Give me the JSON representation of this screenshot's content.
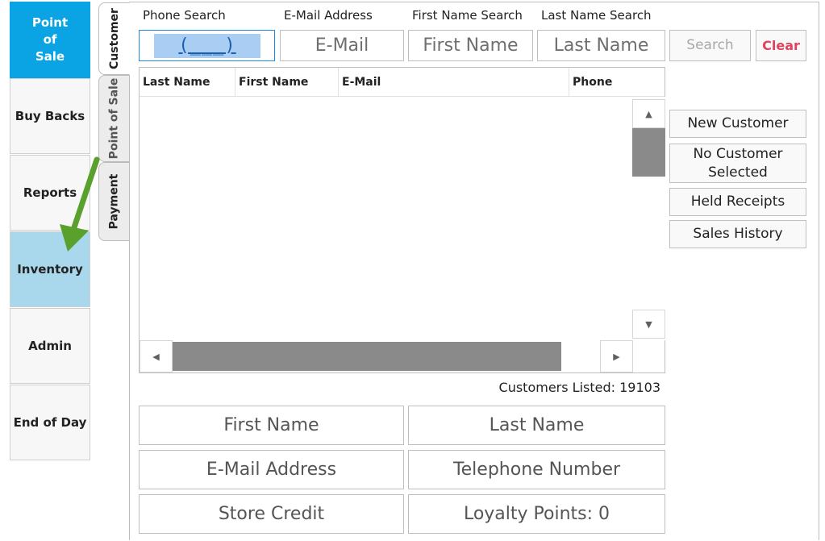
{
  "nav": {
    "pos": "Point\nof\nSale",
    "buy_backs": "Buy Backs",
    "reports": "Reports",
    "inventory": "Inventory",
    "admin": "Admin",
    "end_of_day": "End of Day"
  },
  "tabs": {
    "customer": "Customer",
    "point_of_sale": "Point of Sale",
    "payment": "Payment"
  },
  "search": {
    "phone_label": "Phone Search",
    "phone_mask": "(___) ___-____",
    "email_label": "E-Mail Address",
    "email_placeholder": "E-Mail",
    "first_label": "First Name Search",
    "first_placeholder": "First Name",
    "last_label": "Last Name Search",
    "last_placeholder": "Last Name",
    "search_button": "Search",
    "clear_button": "Clear"
  },
  "grid": {
    "columns": [
      "Last Name",
      "First Name",
      "E-Mail",
      "Phone"
    ],
    "rows": []
  },
  "actions": {
    "new_customer": "New Customer",
    "no_customer_selected": "No Customer Selected",
    "held_receipts": "Held Receipts",
    "sales_history": "Sales History"
  },
  "customers_listed": "Customers Listed: 19103",
  "details": {
    "first_name": "First Name",
    "last_name": "Last Name",
    "email": "E-Mail Address",
    "telephone": "Telephone Number",
    "store_credit": "Store Credit",
    "loyalty_points": "Loyalty Points:  0"
  },
  "colors": {
    "active_nav": "#0aa4e4",
    "highlight_nav": "#a9d8ec",
    "clear_text": "#e0435e",
    "annotation_arrow": "#5aa02c"
  }
}
